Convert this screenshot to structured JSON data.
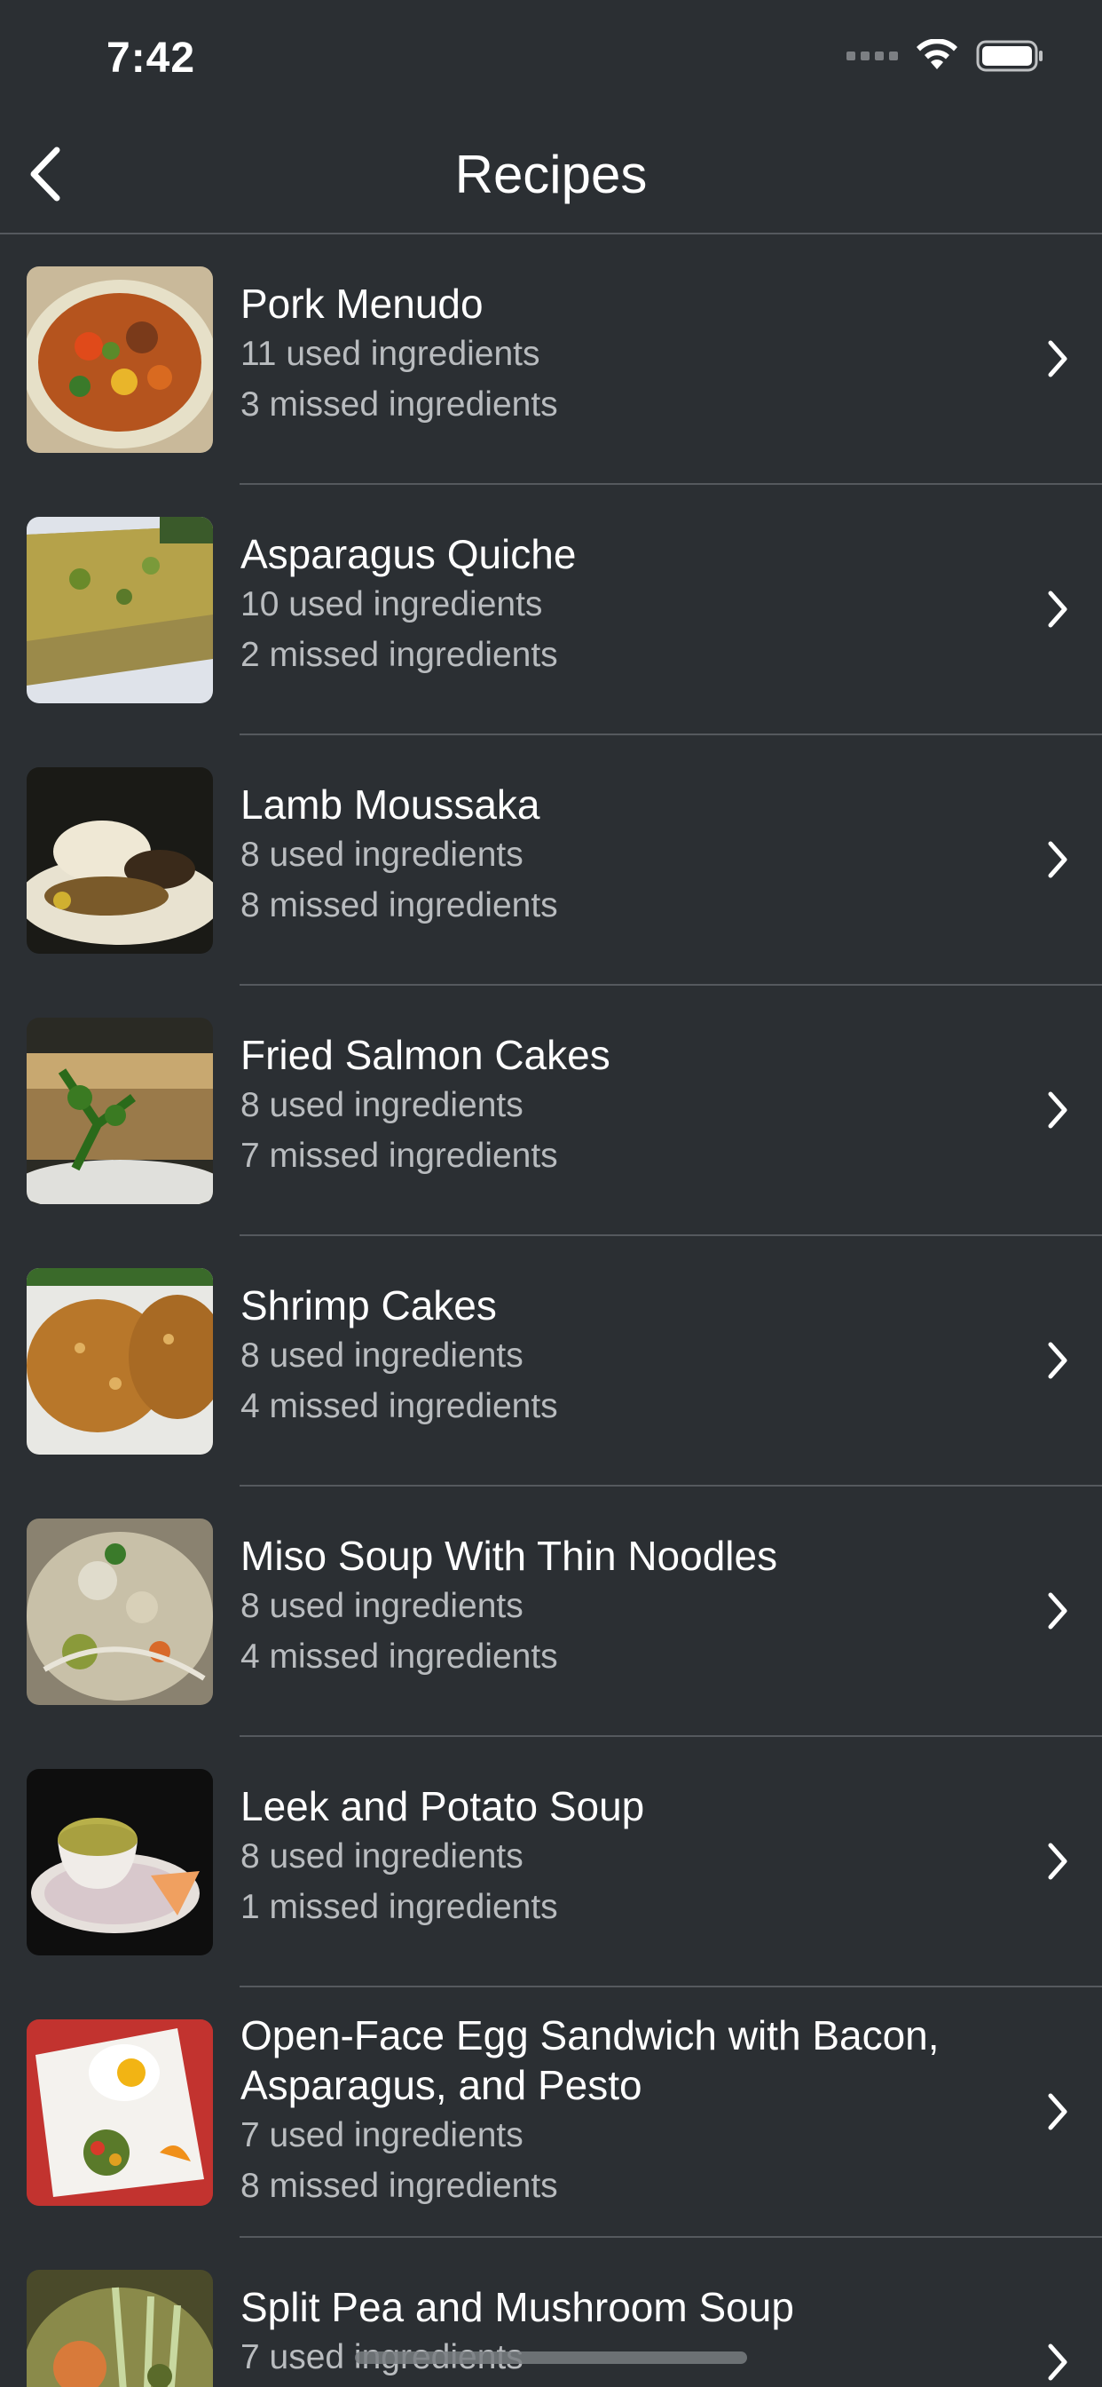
{
  "status_bar": {
    "time": "7:42"
  },
  "nav": {
    "title": "Recipes"
  },
  "recipes": [
    {
      "title": "Pork Menudo",
      "used": "11 used ingredients",
      "missed": "3 missed ingredients"
    },
    {
      "title": "Asparagus Quiche",
      "used": "10 used ingredients",
      "missed": "2 missed ingredients"
    },
    {
      "title": "Lamb Moussaka",
      "used": "8 used ingredients",
      "missed": "8 missed ingredients"
    },
    {
      "title": "Fried Salmon Cakes",
      "used": "8 used ingredients",
      "missed": "7 missed ingredients"
    },
    {
      "title": "Shrimp Cakes",
      "used": "8 used ingredients",
      "missed": "4 missed ingredients"
    },
    {
      "title": "Miso Soup With Thin Noodles",
      "used": "8 used ingredients",
      "missed": "4 missed ingredients"
    },
    {
      "title": "Leek and Potato Soup",
      "used": "8 used ingredients",
      "missed": "1 missed ingredients"
    },
    {
      "title": "Open-Face Egg Sandwich with Bacon, Asparagus, and Pesto",
      "used": "7 used ingredients",
      "missed": "8 missed ingredients"
    },
    {
      "title": "Split Pea and Mushroom Soup",
      "used": "7 used ingredients",
      "missed": ""
    }
  ]
}
